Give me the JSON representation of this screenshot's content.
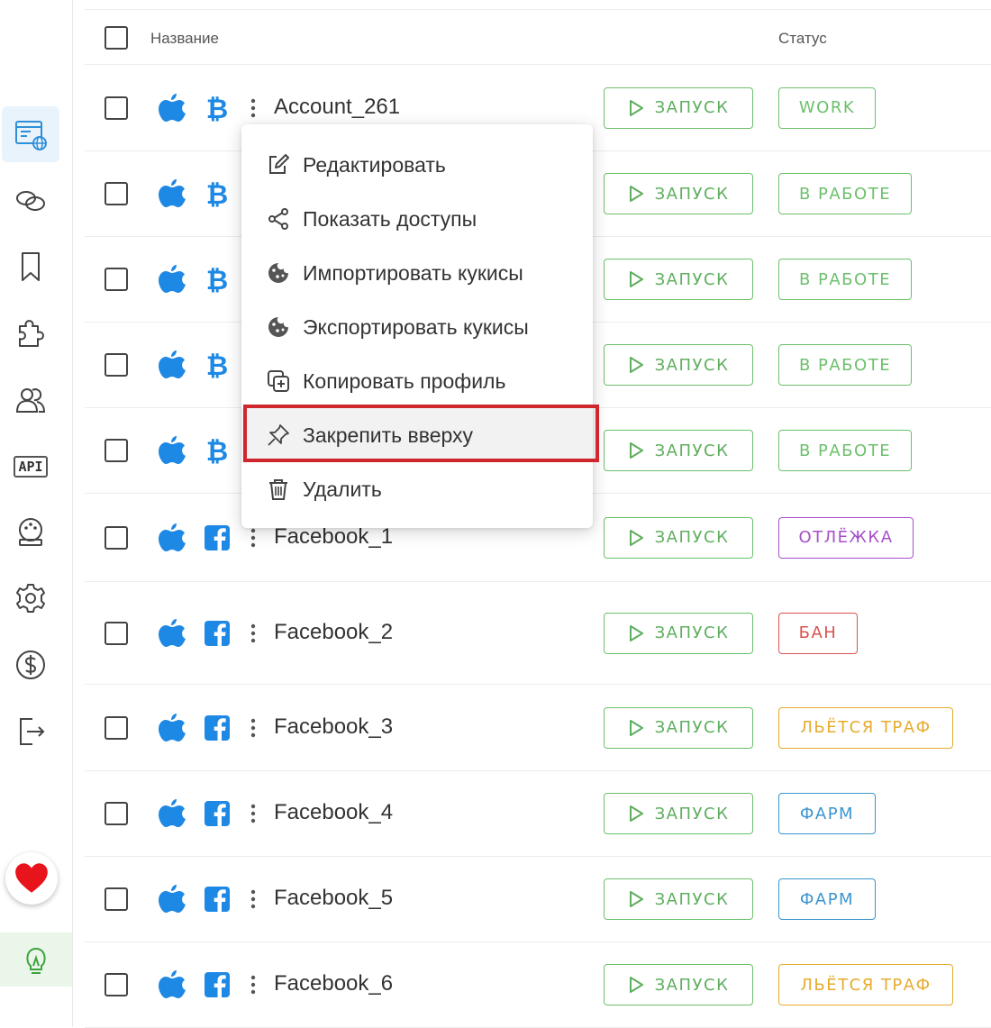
{
  "table": {
    "header": {
      "name": "Название",
      "status": "Статус"
    },
    "rows": [
      {
        "name": "Account_261",
        "platform": "apple-icon",
        "social": "bitcoin-icon",
        "launch": "ЗАПУСК",
        "status": "WORK",
        "status_color": "#6cc06c"
      },
      {
        "name": "",
        "platform": "apple-icon",
        "social": "bitcoin-icon",
        "launch": "ЗАПУСК",
        "status": "В РАБОТЕ",
        "status_color": "#6cc06c"
      },
      {
        "name": "",
        "platform": "apple-icon",
        "social": "bitcoin-icon",
        "launch": "ЗАПУСК",
        "status": "В РАБОТЕ",
        "status_color": "#6cc06c"
      },
      {
        "name": "",
        "platform": "apple-icon",
        "social": "bitcoin-icon",
        "launch": "ЗАПУСК",
        "status": "В РАБОТЕ",
        "status_color": "#6cc06c"
      },
      {
        "name": "",
        "platform": "apple-icon",
        "social": "bitcoin-icon",
        "launch": "ЗАПУСК",
        "status": "В РАБОТЕ",
        "status_color": "#6cc06c"
      },
      {
        "name": "Facebook_1",
        "platform": "apple-icon",
        "social": "facebook-icon",
        "launch": "ЗАПУСК",
        "status": "ОТЛЁЖКА",
        "status_color": "#a64fc9"
      },
      {
        "name": "Facebook_2",
        "platform": "apple-icon",
        "social": "facebook-icon",
        "launch": "ЗАПУСК",
        "status": "БАН",
        "status_color": "#d9534f"
      },
      {
        "name": "Facebook_3",
        "platform": "apple-icon",
        "social": "facebook-icon",
        "launch": "ЗАПУСК",
        "status": "ЛЬЁТСЯ ТРАФ",
        "status_color": "#e6ab2e"
      },
      {
        "name": "Facebook_4",
        "platform": "apple-icon",
        "social": "facebook-icon",
        "launch": "ЗАПУСК",
        "status": "ФАРМ",
        "status_color": "#3a95cf"
      },
      {
        "name": "Facebook_5",
        "platform": "apple-icon",
        "social": "facebook-icon",
        "launch": "ЗАПУСК",
        "status": "ФАРМ",
        "status_color": "#3a95cf"
      },
      {
        "name": "Facebook_6",
        "platform": "apple-icon",
        "social": "facebook-icon",
        "launch": "ЗАПУСК",
        "status": "ЛЬЁТСЯ ТРАФ",
        "status_color": "#e6ab2e"
      }
    ]
  },
  "context_menu": {
    "items": [
      {
        "label": "Редактировать",
        "icon": "edit-icon"
      },
      {
        "label": "Показать доступы",
        "icon": "share-icon"
      },
      {
        "label": "Импортировать кукисы",
        "icon": "cookie-icon"
      },
      {
        "label": "Экспортировать кукисы",
        "icon": "cookie-icon"
      },
      {
        "label": "Копировать профиль",
        "icon": "copy-icon"
      },
      {
        "label": "Закрепить вверху",
        "icon": "pin-icon"
      },
      {
        "label": "Удалить",
        "icon": "trash-icon"
      }
    ],
    "highlighted_index": 5
  },
  "sidebar": {
    "api_label": "API",
    "icons": [
      "browser-profiles-icon",
      "proxy-link-icon",
      "bookmark-icon",
      "extensions-puzzle-icon",
      "team-users-icon",
      "api-icon",
      "automation-robot-icon",
      "settings-gear-icon",
      "billing-dollar-icon",
      "logout-icon",
      "heart-icon",
      "lightbulb-icon"
    ]
  },
  "colors": {
    "accent_blue": "#1e88e5",
    "launch_green": "#6cc06c",
    "highlight_red": "#d0262e"
  }
}
